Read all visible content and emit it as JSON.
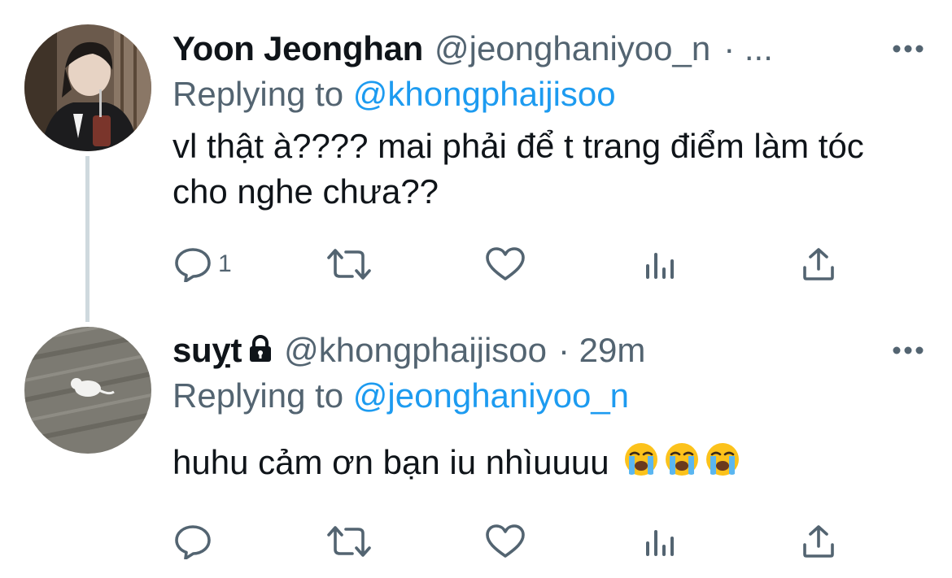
{
  "tweets": [
    {
      "display_name": "Yoon Jeonghan",
      "handle": "@jeonghaniyoo_n",
      "meta": "· ...",
      "locked": false,
      "replying_prefix": "Replying to",
      "replying_to": "@khongphaijisoo",
      "text": "vl thật à???? mai phải để t trang điểm làm tóc cho nghe chưa??",
      "reply_count": "1",
      "icons": [
        "reply-icon",
        "retweet-icon",
        "like-icon",
        "analytics-icon",
        "share-icon",
        "more-icon"
      ]
    },
    {
      "display_name": "suỵt",
      "handle": "@khongphaijisoo",
      "meta": "· 29m",
      "locked": true,
      "replying_prefix": "Replying to",
      "replying_to": "@jeonghaniyoo_n",
      "text": "huhu cảm ơn bạn iu nhìuuuu",
      "emojis": [
        "loudly-crying-face-emoji",
        "loudly-crying-face-emoji",
        "loudly-crying-face-emoji"
      ],
      "reply_count": "",
      "icons": [
        "reply-icon",
        "retweet-icon",
        "like-icon",
        "analytics-icon",
        "share-icon",
        "more-icon"
      ]
    }
  ],
  "colors": {
    "text": "#0f1419",
    "secondary": "#536471",
    "link": "#1d9bf0",
    "thread_line": "#cfd9de",
    "background": "#ffffff"
  }
}
